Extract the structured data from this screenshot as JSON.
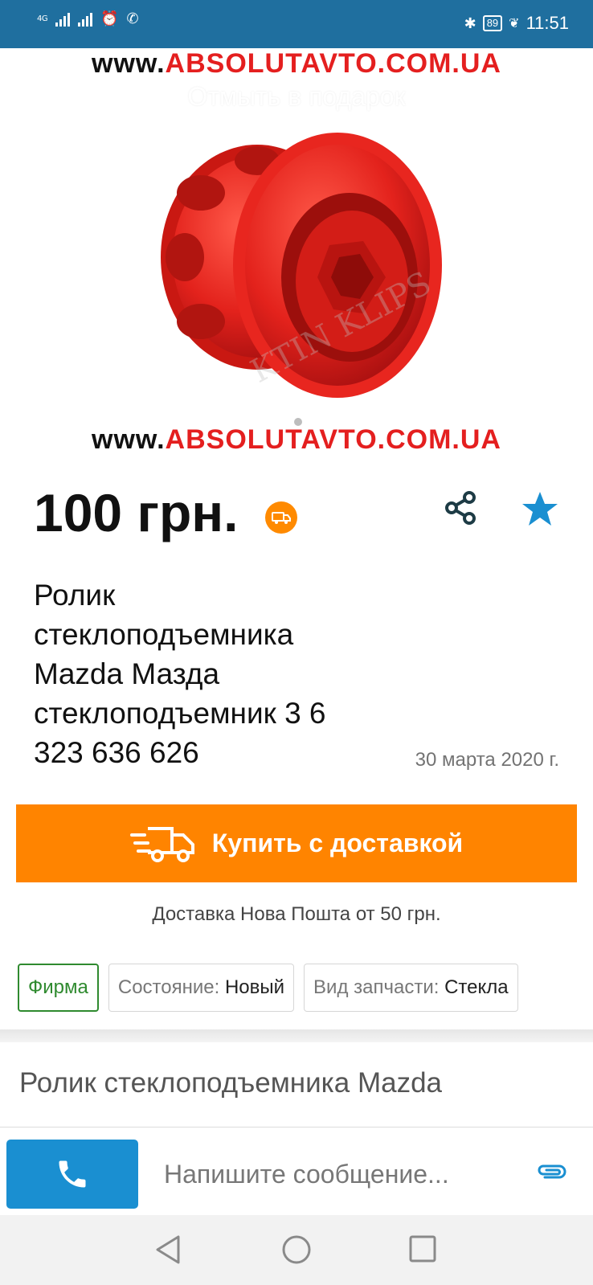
{
  "status_bar": {
    "network": "4G",
    "time": "11:51",
    "battery": "89"
  },
  "hero": {
    "watermark_prefix": "www.",
    "watermark_domain": "ABSOLUTAVTO.COM.UA",
    "overlay_text": "Отмыть в подарок",
    "logo_watermark": "KTIN KLIPS"
  },
  "listing": {
    "price": "100 грн.",
    "title": "Ролик стеклоподъемника Mazda Мазда стеклоподъемник 3 6 323 636 626",
    "date": "30 марта 2020 г.",
    "buy_button": "Купить с доставкой",
    "shipping": "Доставка Нова Пошта от 50 грн.",
    "tags": {
      "firm": "Фирма",
      "condition_label": "Состояние:",
      "condition_value": "Новый",
      "part_label": "Вид запчасти:",
      "part_value": "Стекла"
    },
    "description_title": "Ролик стеклоподъемника Mazda"
  },
  "chat": {
    "message_placeholder": "Напишите сообщение..."
  },
  "colors": {
    "status_bar": "#1f6f9f",
    "accent_orange": "#ff8400",
    "call_blue": "#1a8fd1",
    "star_blue": "#1a8fd1",
    "firm_green": "#2f8a2f",
    "watermark_red": "#e41f1f"
  },
  "icons": {
    "share": "share-icon",
    "favorite": "star-icon",
    "delivery": "delivery-truck-icon",
    "phone": "phone-icon",
    "attach": "paperclip-icon"
  }
}
